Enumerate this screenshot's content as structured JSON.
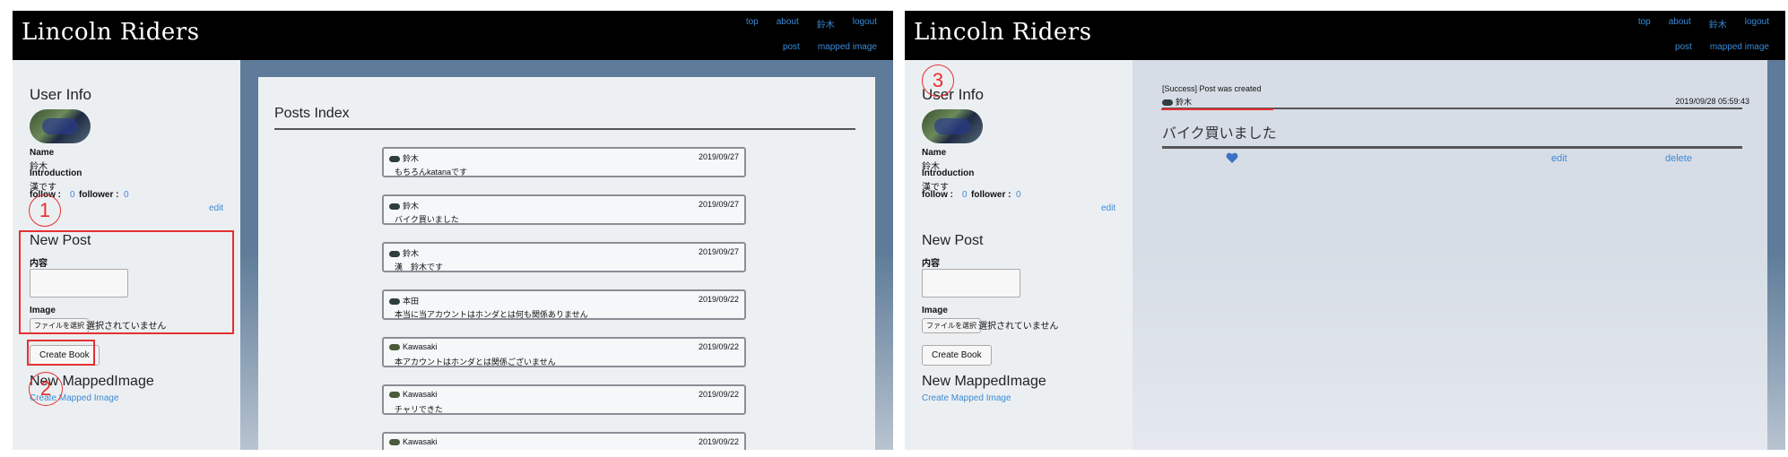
{
  "app": {
    "brand": "Lincoln Riders"
  },
  "nav": {
    "row1": [
      "top",
      "about",
      "鈴木",
      "logout"
    ],
    "row2": [
      "post",
      "mapped image"
    ]
  },
  "sidebar": {
    "user_info_title": "User Info",
    "name_label": "Name",
    "name_value": "鈴木",
    "intro_label": "Introduction",
    "intro_value": "漢です",
    "follow_label": "follow :",
    "follow_count": "0",
    "follower_label": "follower :",
    "follower_count": "0",
    "edit_link": "edit",
    "new_post_title": "New Post",
    "content_label": "内容",
    "image_label": "Image",
    "file_button": "ファイルを選択",
    "file_status": "選択されていません",
    "create_button": "Create Book",
    "mapped_title": "New MappedImage",
    "mapped_link": "Create Mapped Image"
  },
  "posts_index": {
    "title": "Posts Index",
    "posts": [
      {
        "author": "鈴木",
        "date": "2019/09/27",
        "text": "もちろんkatanaです"
      },
      {
        "author": "鈴木",
        "date": "2019/09/27",
        "text": "バイク買いました"
      },
      {
        "author": "鈴木",
        "date": "2019/09/27",
        "text": "漢　鈴木です"
      },
      {
        "author": "本田",
        "date": "2019/09/22",
        "text": "本当に当アカウントはホンダとは何も関係ありません"
      },
      {
        "author": "Kawasaki",
        "date": "2019/09/22",
        "text": "本アカウントはホンダとは関係ございません"
      },
      {
        "author": "Kawasaki",
        "date": "2019/09/22",
        "text": "チャリできた"
      },
      {
        "author": "Kawasaki",
        "date": "2019/09/22",
        "text": ""
      }
    ]
  },
  "post_detail": {
    "flash": "[Success] Post was created",
    "author": "鈴木",
    "datetime": "2019/09/28 05:59:43",
    "body": "バイク買いました",
    "like_icon": "heart-icon",
    "edit": "edit",
    "delete": "delete"
  },
  "annotations": [
    "1",
    "2",
    "3"
  ],
  "colors": {
    "accent": "#3b8bd6",
    "annotation": "#e53030",
    "navbar": "#000000"
  }
}
